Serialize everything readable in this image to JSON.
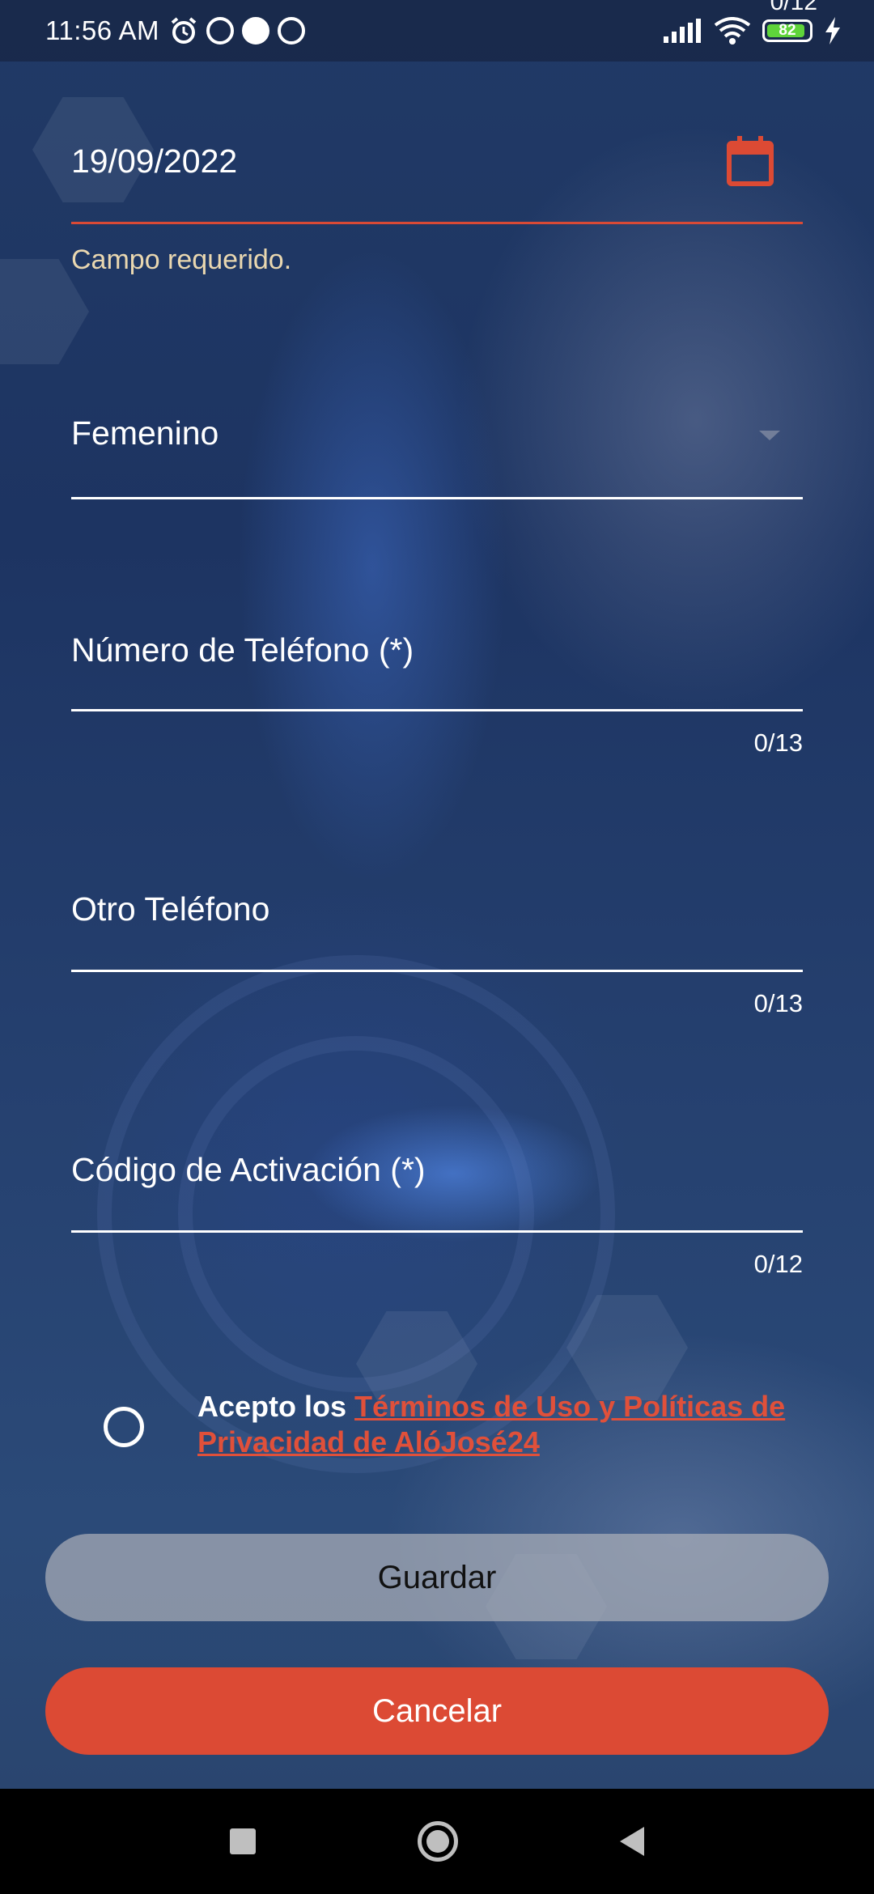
{
  "status_bar": {
    "time": "11:56 AM",
    "battery_level": "82",
    "icons": [
      "alarm-icon",
      "app-notification-icon",
      "sync-icon",
      "app-notification-icon",
      "signal-icon",
      "wifi-icon",
      "battery-icon",
      "charging-icon"
    ],
    "cut_counter": "0/12"
  },
  "form": {
    "birth_date": {
      "value": "19/09/2022",
      "error": "Campo requerido.",
      "icon": "calendar-icon"
    },
    "gender": {
      "selected": "Femenino"
    },
    "phone": {
      "label": "Número de Teléfono (*)",
      "counter": "0/13"
    },
    "other_phone": {
      "label": "Otro Teléfono",
      "counter": "0/13"
    },
    "activation_code": {
      "label": "Código de Activación (*)",
      "counter": "0/12"
    },
    "terms": {
      "prefix": "Acepto los ",
      "link": "Términos de Uso y Políticas de Privacidad de AlóJosé24"
    }
  },
  "buttons": {
    "save": "Guardar",
    "cancel": "Cancelar"
  },
  "colors": {
    "accent": "#dc4a34",
    "error_text": "#e9d7b0",
    "link": "#e0503a"
  }
}
